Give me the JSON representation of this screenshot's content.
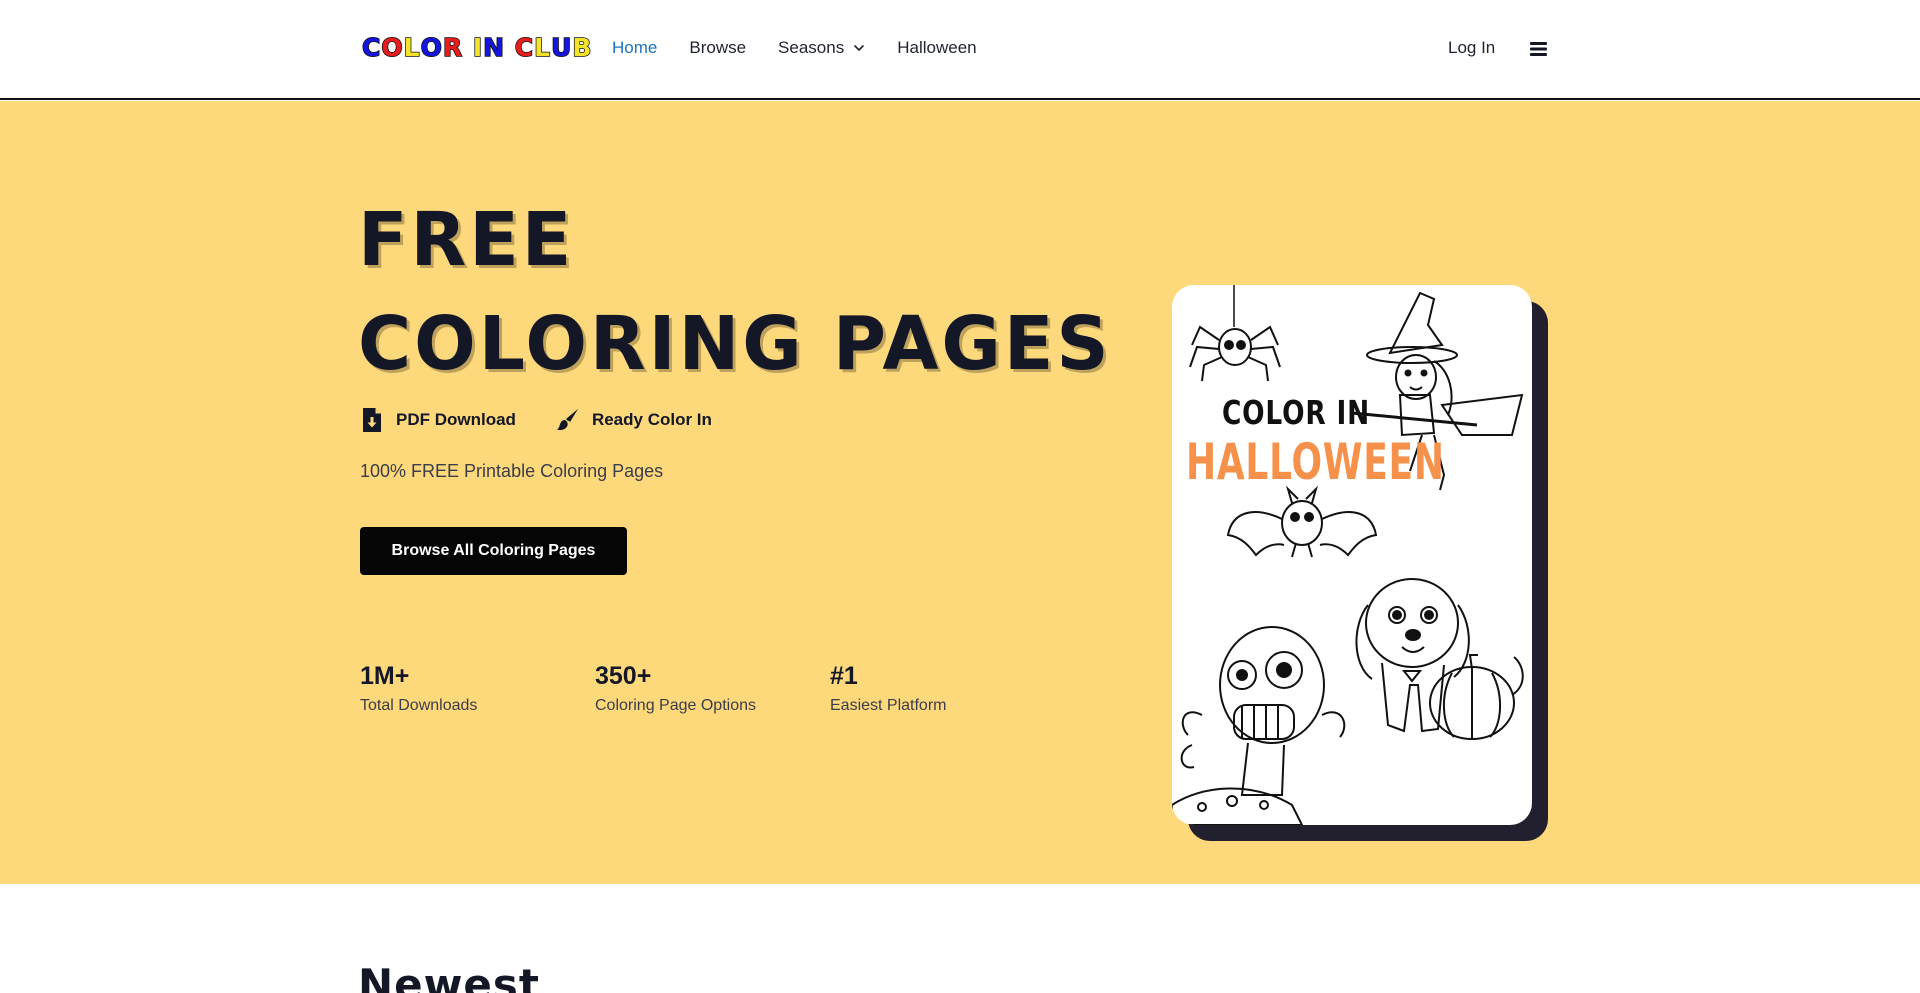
{
  "header": {
    "logo": {
      "letters": [
        {
          "ch": "C",
          "color": "#1515e0"
        },
        {
          "ch": "O",
          "color": "#e81c1c"
        },
        {
          "ch": "L",
          "color": "#f5e42a"
        },
        {
          "ch": "O",
          "color": "#1515e0"
        },
        {
          "ch": "R",
          "color": "#e81c1c"
        },
        {
          "ch": " ",
          "color": "#000000"
        },
        {
          "ch": "I",
          "color": "#f5e42a"
        },
        {
          "ch": "N",
          "color": "#1515e0"
        },
        {
          "ch": " ",
          "color": "#000000"
        },
        {
          "ch": "C",
          "color": "#e81c1c"
        },
        {
          "ch": "L",
          "color": "#f5e42a"
        },
        {
          "ch": "U",
          "color": "#1515e0"
        },
        {
          "ch": "B",
          "color": "#f5e42a"
        }
      ]
    },
    "nav": {
      "home": "Home",
      "browse": "Browse",
      "seasons": "Seasons",
      "halloween": "Halloween"
    },
    "login": "Log In",
    "menu_icon": "hamburger-icon"
  },
  "hero": {
    "title_line1": "FREE",
    "title_line2": "COLORING PAGES",
    "features": [
      {
        "label": "PDF Download",
        "icon": "file-download-icon"
      },
      {
        "label": "Ready Color In",
        "icon": "paintbrush-icon"
      }
    ],
    "subtitle": "100% FREE Printable Coloring Pages",
    "cta": "Browse All Coloring Pages",
    "stats": [
      {
        "value": "1M+",
        "label": "Total Downloads"
      },
      {
        "value": "350+",
        "label": "Coloring Page Options"
      },
      {
        "value": "#1",
        "label": "Easiest Platform"
      }
    ],
    "card": {
      "line1": "COLOR IN",
      "line2": "HALLOWEEN"
    }
  },
  "newest": {
    "heading": "Newest"
  },
  "colors": {
    "hero_bg": "#fed97b",
    "accent_link": "#1e73be",
    "card_orange": "#f5914a",
    "dark": "#141726"
  }
}
